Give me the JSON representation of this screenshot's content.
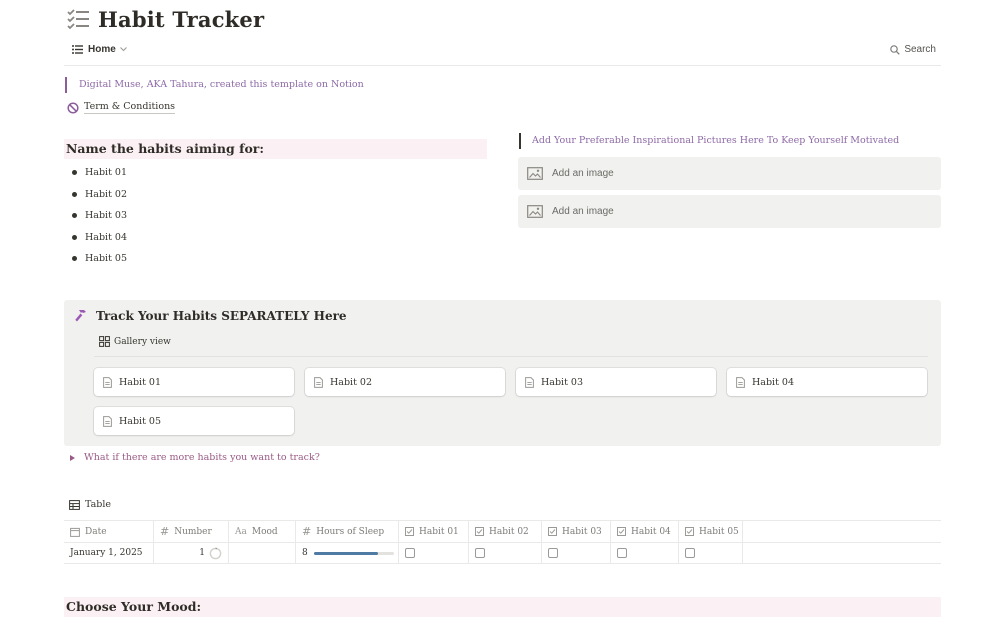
{
  "page": {
    "title": "Habit Tracker",
    "title_icon": "checklist-icon"
  },
  "tabbar": {
    "home_label": "Home",
    "search_label": "Search"
  },
  "intro": {
    "quote": "Digital Muse, AKA Tahura, created this template on Notion",
    "terms_label": "Term & Conditions"
  },
  "habits": {
    "heading": "Name the habits aiming for:",
    "items": [
      "Habit 01",
      "Habit 02",
      "Habit 03",
      "Habit 04",
      "Habit 05"
    ]
  },
  "inspiration": {
    "quote": "Add Your Preferable Inspirational Pictures Here To Keep Yourself Motivated",
    "placeholders": [
      "Add an image",
      "Add an image"
    ]
  },
  "tracker": {
    "title": "Track Your Habits SEPARATELY Here",
    "view_label": "Gallery view",
    "cards": [
      "Habit 01",
      "Habit 02",
      "Habit 03",
      "Habit 04",
      "Habit 05"
    ],
    "accent": "#9b59b6"
  },
  "toggle": {
    "label": "What if there are more habits you want to track?"
  },
  "table": {
    "view_label": "Table",
    "columns": [
      "Date",
      "Number",
      "Mood",
      "Hours of Sleep",
      "Habit 01",
      "Habit 02",
      "Habit 03",
      "Habit 04",
      "Habit 05"
    ],
    "rows": [
      {
        "date": "January 1, 2025",
        "number": "1",
        "mood": "",
        "hours_of_sleep": "8",
        "sleep_progress": 0.8,
        "habits": [
          false,
          false,
          false,
          false,
          false
        ]
      }
    ]
  },
  "mood": {
    "heading": "Choose Your Mood:"
  },
  "colors": {
    "quote_text": "#8d6aa6",
    "heading_bg": "#fbf1f4",
    "callout_bg": "#f1f1ef",
    "progress": "#4f7aa3"
  }
}
